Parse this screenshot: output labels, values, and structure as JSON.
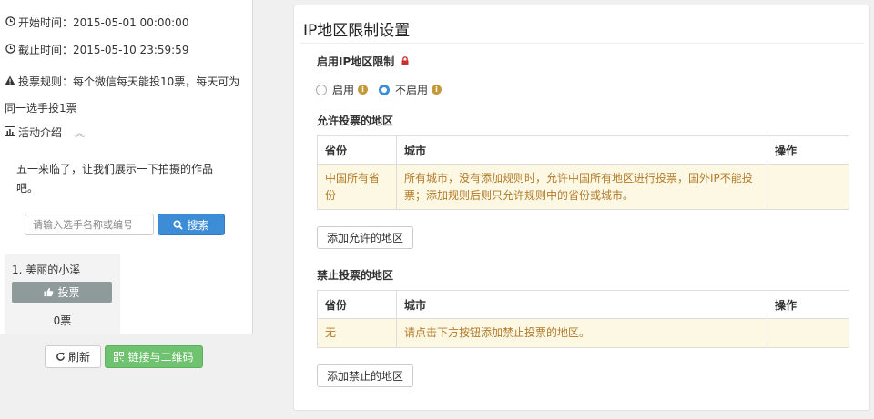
{
  "activity": {
    "start": "开始时间：2015-05-01 00:00:00",
    "end": "截止时间：2015-05-10 23:59:59",
    "rule": "投票规则：每个微信每天能投10票，每天可为同一选手投1票",
    "intro_label": "活动介绍",
    "intro_text": "五一来临了，让我们展示一下拍摄的作品吧。"
  },
  "search": {
    "placeholder": "请输入选手名称或编号",
    "button_label": "搜索"
  },
  "candidate": {
    "title": "1. 美丽的小溪",
    "vote_label": "投票",
    "count": "0票"
  },
  "actions": {
    "refresh_label": "刷新",
    "qr_label": "链接与二维码"
  },
  "settings": {
    "title": "IP地区限制设置",
    "enable_label": "启用IP地区限制",
    "radio_enable": "启用",
    "radio_disable": "不启用",
    "allow_label": "允许投票的地区",
    "deny_label": "禁止投票的地区",
    "headers": {
      "province": "省份",
      "city": "城市",
      "action": "操作"
    },
    "allow_rows": [
      {
        "province": "中国所有省份",
        "city": "所有城市，没有添加规则时，允许中国所有地区进行投票，国外IP不能投票；添加规则后则只允许规则中的省份或城市。",
        "action": ""
      }
    ],
    "deny_rows": [
      {
        "province": "无",
        "city": "请点击下方按钮添加禁止投票的地区。",
        "action": ""
      }
    ],
    "add_allow_label": "添加允许的地区",
    "add_deny_label": "添加禁止的地区",
    "selected_radio": "disable"
  },
  "icons": {
    "clock": "clock-icon",
    "warning": "warning-icon",
    "chart": "bar-chart-icon",
    "chevron": "chevron-up-icon",
    "search": "search-icon",
    "thumb": "thumbs-up-icon",
    "refresh": "refresh-icon",
    "qr": "qrcode-icon",
    "lock": "lock-icon",
    "info": "info-icon"
  },
  "colors": {
    "primary": "#3c8dd6",
    "success": "#6fc26f",
    "warning_text": "#b37a2a",
    "warning_bg": "#fcf8e3",
    "lock": "#c9302c"
  }
}
